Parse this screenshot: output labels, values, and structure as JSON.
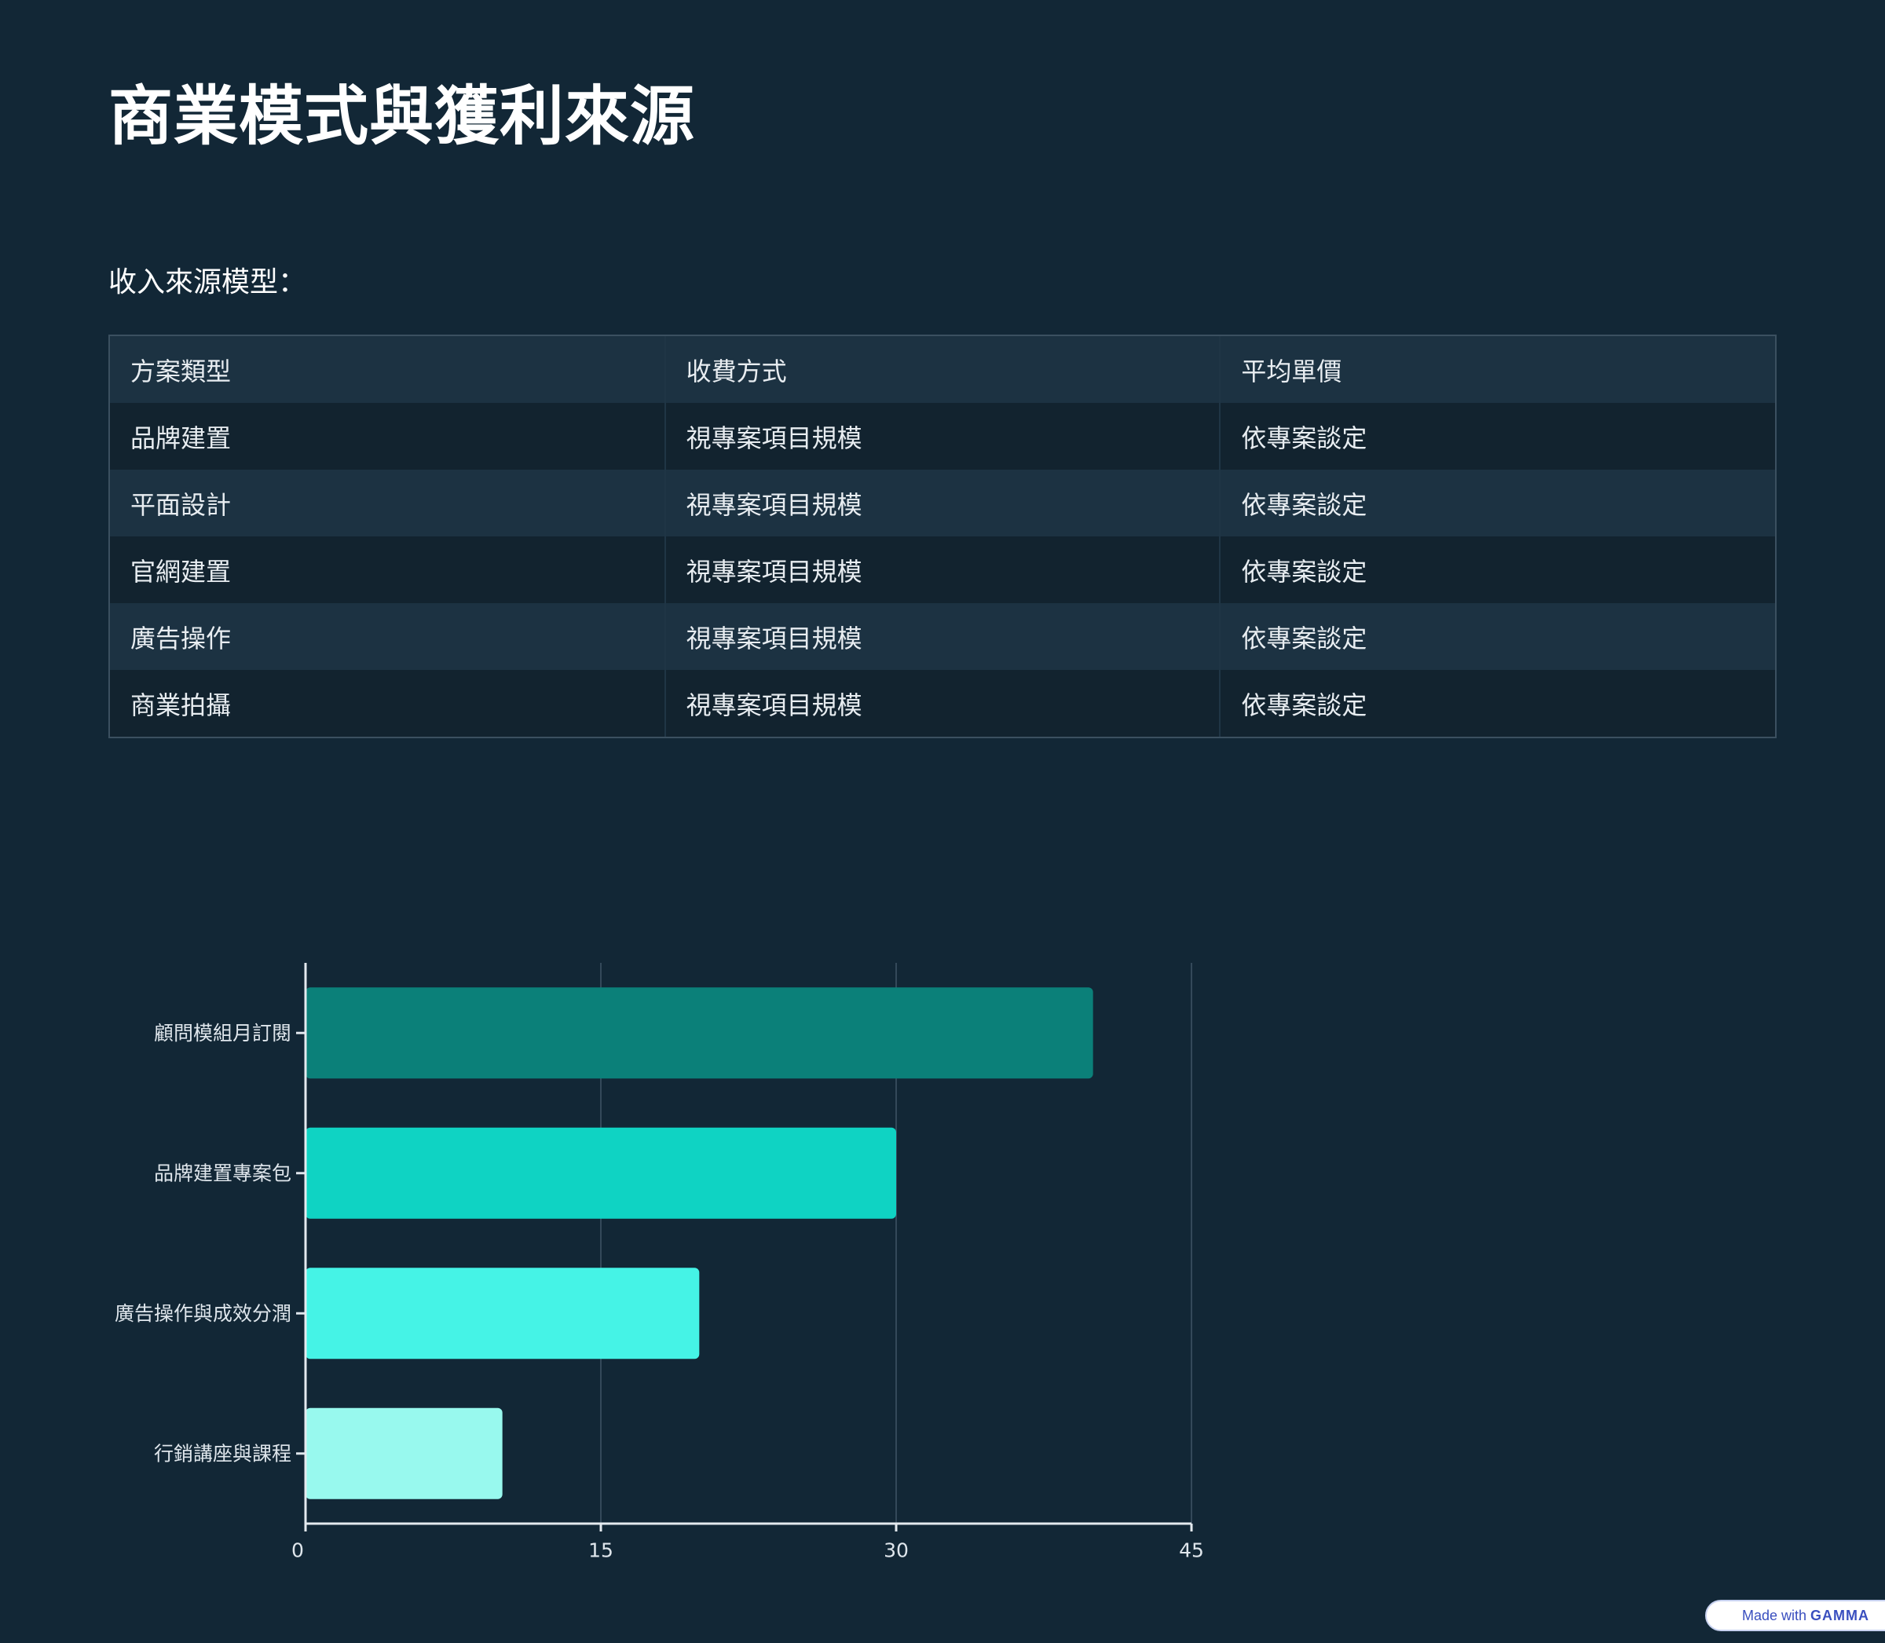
{
  "title": "商業模式與獲利來源",
  "section_label": "收入來源模型：",
  "table": {
    "headers": [
      "方案類型",
      "收費方式",
      "平均單價"
    ],
    "rows": [
      [
        "品牌建置",
        "視專案項目規模",
        "依專案談定"
      ],
      [
        "平面設計",
        "視專案項目規模",
        "依專案談定"
      ],
      [
        "官網建置",
        "視專案項目規模",
        "依專案談定"
      ],
      [
        "廣告操作",
        "視專案項目規模",
        "依專案談定"
      ],
      [
        "商業拍攝",
        "視專案項目規模",
        "依專案談定"
      ]
    ]
  },
  "chart_data": {
    "type": "bar",
    "orientation": "horizontal",
    "categories": [
      "顧問模組月訂閱",
      "品牌建置專案包",
      "廣告操作與成效分潤",
      "行銷講座與課程"
    ],
    "values": [
      40,
      30,
      20,
      10
    ],
    "colors": [
      "#0b8079",
      "#0fd3c3",
      "#45f3e6",
      "#98f9ee"
    ],
    "xlim": [
      0,
      45
    ],
    "xticks": [
      0,
      15,
      30,
      45
    ],
    "grid": true,
    "legend": "none",
    "title": "",
    "xlabel": "",
    "ylabel": ""
  },
  "footer": {
    "made_with": "Made with",
    "brand": "GAMMA"
  }
}
